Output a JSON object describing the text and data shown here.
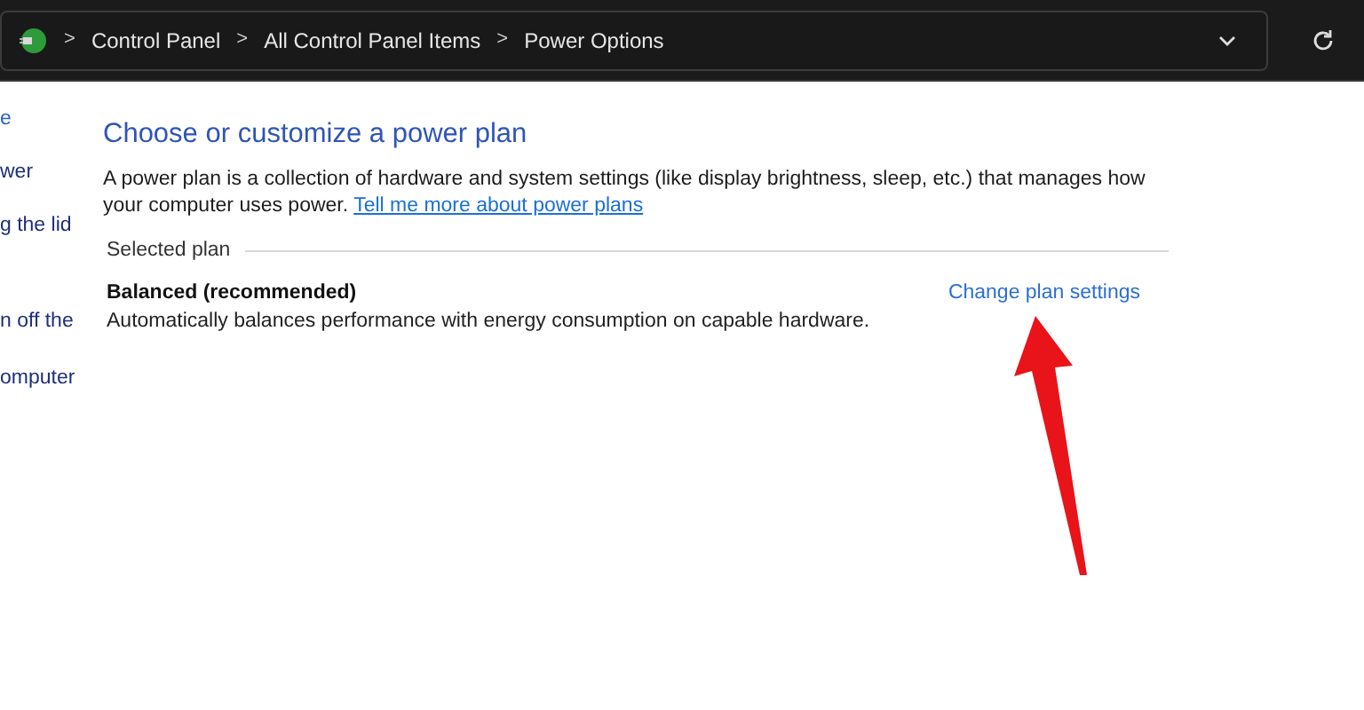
{
  "address_bar": {
    "breadcrumbs": [
      "Control Panel",
      "All Control Panel Items",
      "Power Options"
    ],
    "separator": ">"
  },
  "sidebar": {
    "items": [
      {
        "label": "e"
      },
      {
        "label": "wer"
      },
      {
        "label": "g the lid"
      },
      {
        "label": "n off the"
      },
      {
        "label": "omputer"
      }
    ]
  },
  "content": {
    "heading": "Choose or customize a power plan",
    "description": "A power plan is a collection of hardware and system settings (like display brightness, sleep, etc.) that manages how your computer uses power.",
    "link": "Tell me more about power plans",
    "section_label": "Selected plan",
    "plan": {
      "name": "Balanced (recommended)",
      "description": "Automatically balances performance with energy consumption on capable hardware.",
      "action": "Change plan settings"
    }
  }
}
